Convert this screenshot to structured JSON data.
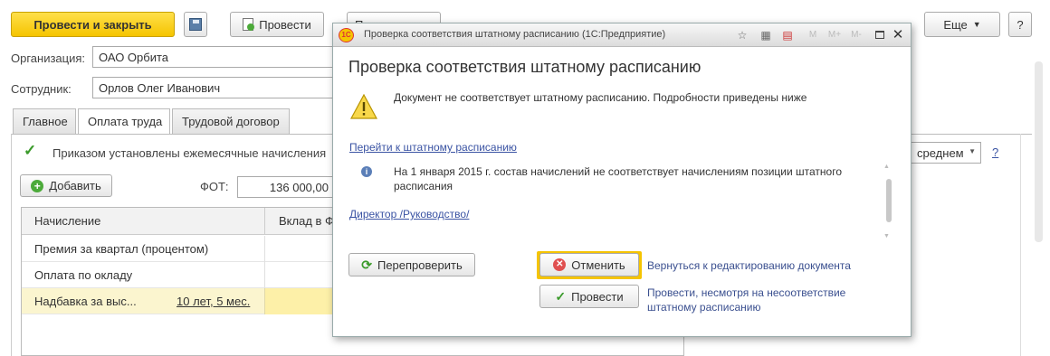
{
  "toolbar": {
    "post_close": "Провести и закрыть",
    "post": "Провести",
    "print_partial": "Печать",
    "more": "Еще",
    "help": "?"
  },
  "form": {
    "org_label": "Организация:",
    "org_value": "ОАО Орбита",
    "employee_label": "Сотрудник:",
    "employee_value": "Орлов Олег Иванович"
  },
  "tabs": [
    "Главное",
    "Оплата труда",
    "Трудовой договор"
  ],
  "pay": {
    "monthly_checkbox_label": "Приказом установлены ежемесячные начисления",
    "add_button": "Добавить",
    "fot_label": "ФОТ:",
    "fot_value": "136 000,00",
    "avg_dropdown": "среднем",
    "help": "?"
  },
  "table": {
    "headers": [
      "Начисление",
      "Вклад в Ф"
    ],
    "rows": [
      {
        "name": "Премия за квартал (процентом)",
        "extra": ""
      },
      {
        "name": "Оплата по окладу",
        "extra": ""
      },
      {
        "name": "Надбавка за выс...",
        "extra": "10 лет, 5 мес."
      }
    ]
  },
  "dialog": {
    "window_title": "Проверка соответствия штатному расписанию  (1С:Предприятие)",
    "title_tools": [
      "M",
      "M+",
      "M-"
    ],
    "heading": "Проверка соответствия штатному расписанию",
    "warning_text": "Документ не соответствует штатному расписанию. Подробности приведены ниже",
    "staff_link": "Перейти к штатному расписанию",
    "info_text": "На 1 января 2015 г. состав начислений не соответствует начислениям позиции штатного расписания",
    "position_link": "Директор /Руководство/",
    "recheck_button": "Перепроверить",
    "cancel_button": "Отменить",
    "cancel_desc": "Вернуться к редактированию документа",
    "post_button": "Провести",
    "post_desc": "Провести, несмотря на несоответствие штатному расписанию"
  },
  "colors": {
    "accent_yellow": "#f5c400",
    "link_blue": "#3a53a3",
    "selected_row": "#fbf5cf"
  }
}
